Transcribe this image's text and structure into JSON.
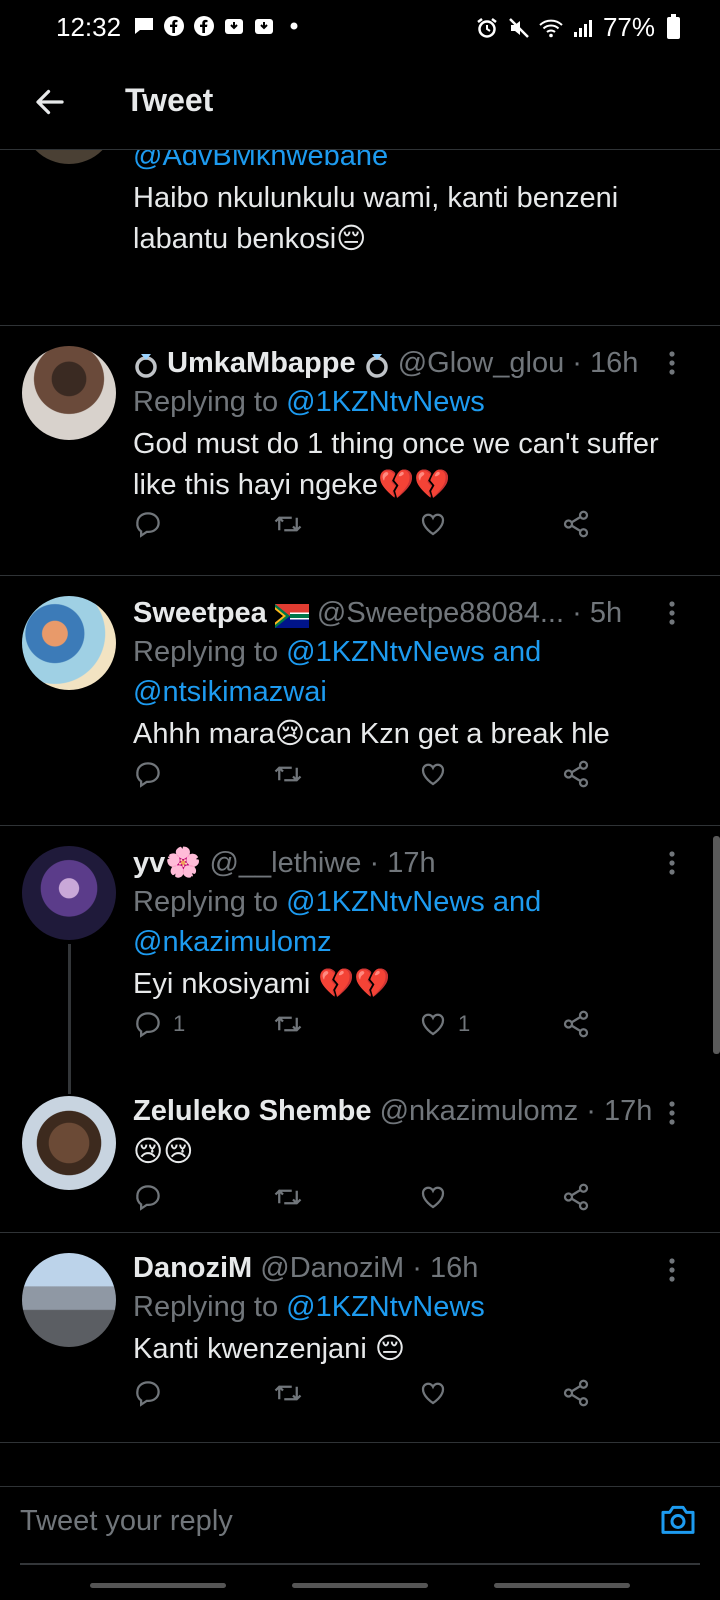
{
  "status_bar": {
    "time": "12:32",
    "battery": "77%"
  },
  "header": {
    "title": "Tweet"
  },
  "partial_tweet": {
    "handle_fragment": "@AdvBMkhwebane",
    "text": "Haibo nkulunkulu wami, kanti benzeni labantu benkosi😔"
  },
  "tweets": [
    {
      "name": "UmkaMbappe",
      "handle": "@Glow_glou",
      "time": "16h",
      "replying_prefix": "Replying to ",
      "replying_to": "@1KZNtvNews",
      "replying_to_2": "",
      "text": "God must do 1 thing once we can't suffer like this hayi ngeke💔💔",
      "reply_count": "",
      "like_count": ""
    },
    {
      "name": "Sweetpea",
      "handle": "@Sweetpe88084...",
      "time": "5h",
      "replying_prefix": "Replying to ",
      "replying_to": "@1KZNtvNews and",
      "replying_to_2": "@ntsikimazwai",
      "text": "Ahhh mara😢can Kzn get a break hle",
      "reply_count": "",
      "like_count": ""
    },
    {
      "name": "yv🌸",
      "handle": "@__lethiwe",
      "time": "17h",
      "replying_prefix": "Replying to ",
      "replying_to": "@1KZNtvNews and",
      "replying_to_2": "@nkazimulomz",
      "text": "Eyi nkosiyami 💔💔",
      "reply_count": "1",
      "like_count": "1"
    },
    {
      "name": "Zeluleko Shembe",
      "handle": "@nkazimulomz",
      "time": "17h",
      "text": "😢😢",
      "reply_count": "",
      "like_count": ""
    },
    {
      "name": "DanoziM",
      "handle": "@DanoziM",
      "time": "16h",
      "replying_prefix": "Replying to ",
      "replying_to": "@1KZNtvNews",
      "replying_to_2": "",
      "text": "Kanti kwenzenjani 😔",
      "reply_count": "",
      "like_count": ""
    }
  ],
  "separator": " · ",
  "reply_bar": {
    "placeholder": "Tweet your reply"
  },
  "colors": {
    "accent": "#1d9bf0",
    "secondary_text": "#71767b",
    "background": "#000000"
  },
  "icons": [
    "back-arrow-icon",
    "reply-icon",
    "retweet-icon",
    "like-icon",
    "share-icon",
    "more-icon",
    "camera-icon"
  ]
}
